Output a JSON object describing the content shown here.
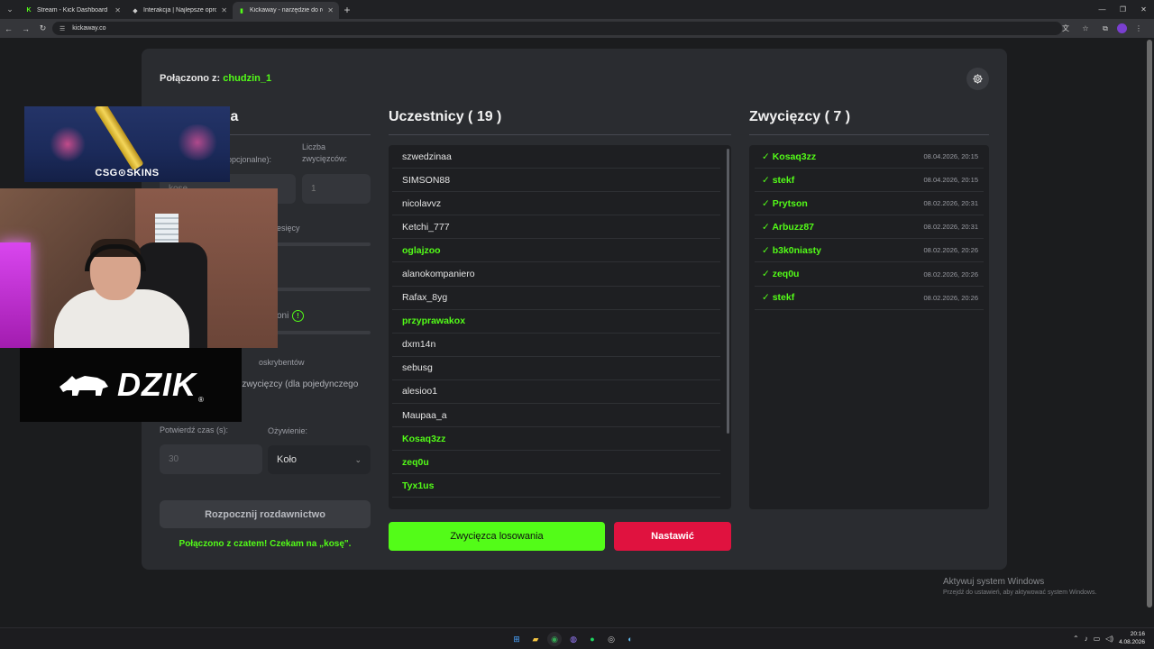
{
  "browser": {
    "tabs": [
      {
        "title": "Stream - Kick Dashboard",
        "active": false
      },
      {
        "title": "Interakcja | Najlepsze oprogram",
        "active": false
      },
      {
        "title": "Kickaway - narzędzie do rozdan",
        "active": true
      }
    ],
    "url": "kickaway.co"
  },
  "page": {
    "connected_label": "Połączono z:",
    "connected_user": "chudzin_1",
    "settings": {
      "title_partial": "ia",
      "keyword_label_partial": "opcjonalne):",
      "winners_count_label": "Liczba zwycięzców:",
      "keyword_value_partial": "kosę",
      "winners_count_value": "1",
      "months_label_partial": "niesięcy",
      "info_label_partial": "oni",
      "subs_label_partial": "oskrybentów",
      "single_winner_label_partial": "e zwycięzcy (dla pojedynczego",
      "confirm_time_label": "Potwierdź czas (s):",
      "animation_label": "Ożywienie:",
      "confirm_time_placeholder": "30",
      "animation_value": "Koło",
      "start_button": "Rozpocznij rozdawnictwo",
      "status_message": "Połączono z czatem! Czekam na „kosę\"."
    },
    "participants": {
      "title": "Uczestnicy ( 19 )",
      "items": [
        {
          "name": "szwedzinaa",
          "highlight": false
        },
        {
          "name": "SIMSON88",
          "highlight": false
        },
        {
          "name": "nicolavvz",
          "highlight": false
        },
        {
          "name": "Ketchi_777",
          "highlight": false
        },
        {
          "name": "oglajzoo",
          "highlight": true
        },
        {
          "name": "alanokompaniero",
          "highlight": false
        },
        {
          "name": "Rafax_8yg",
          "highlight": false
        },
        {
          "name": "przyprawakox",
          "highlight": true
        },
        {
          "name": "dxm14n",
          "highlight": false
        },
        {
          "name": "sebusg",
          "highlight": false
        },
        {
          "name": "alesioo1",
          "highlight": false
        },
        {
          "name": "Maupaa_a",
          "highlight": false
        },
        {
          "name": "Kosaq3zz",
          "highlight": true
        },
        {
          "name": "zeq0u",
          "highlight": true
        },
        {
          "name": "Tyx1us",
          "highlight": true
        }
      ],
      "draw_button": "Zwycięzca losowania",
      "reset_button": "Nastawić"
    },
    "winners": {
      "title": "Zwycięzcy ( 7 )",
      "items": [
        {
          "name": "✓ Kosaq3zz",
          "date": "08.04.2026, 20:15"
        },
        {
          "name": "✓ stekf",
          "date": "08.04.2026, 20:15"
        },
        {
          "name": "✓ Prytson",
          "date": "08.02.2026, 20:31"
        },
        {
          "name": "✓ Arbuzz87",
          "date": "08.02.2026, 20:31"
        },
        {
          "name": "✓ b3k0niasty",
          "date": "08.02.2026, 20:26"
        },
        {
          "name": "✓ zeq0u",
          "date": "08.02.2026, 20:26"
        },
        {
          "name": "✓ stekf",
          "date": "08.02.2026, 20:26"
        }
      ]
    }
  },
  "overlays": {
    "sponsor_brand": "CSG⊙SKINS",
    "dzik_word": "DZIK",
    "dzik_reg": "®"
  },
  "windows": {
    "activate_title": "Aktywuj system Windows",
    "activate_sub": "Przejdź do ustawień, aby aktywować system Windows.",
    "clock_time": "20:16",
    "clock_date": "4.08.2026"
  },
  "colors": {
    "accent": "#53fc18",
    "danger": "#e0123f",
    "card": "#2a2c30",
    "list_bg": "#1e1f22"
  }
}
